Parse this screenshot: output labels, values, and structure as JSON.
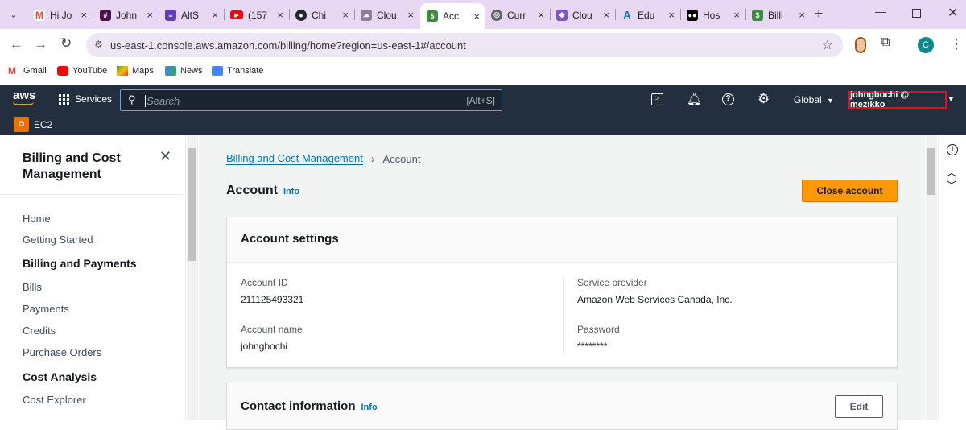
{
  "browser": {
    "tabs": [
      {
        "label": "Hi Jo",
        "icon": "gmail-icon"
      },
      {
        "label": "John",
        "icon": "slack-icon"
      },
      {
        "label": "AltS",
        "icon": "forms-icon"
      },
      {
        "label": "(157",
        "icon": "youtube-icon"
      },
      {
        "label": "Chi",
        "icon": "github-icon"
      },
      {
        "label": "Clou",
        "icon": "cloud-icon"
      },
      {
        "label": "Acc",
        "icon": "billing-icon",
        "active": true
      },
      {
        "label": "Curr",
        "icon": "globe-icon"
      },
      {
        "label": "Clou",
        "icon": "cloud-purple-icon"
      },
      {
        "label": "Edu",
        "icon": "azure-icon"
      },
      {
        "label": "Hos",
        "icon": "medium-icon"
      },
      {
        "label": "Billi",
        "icon": "billing-icon"
      }
    ],
    "url": "us-east-1.console.aws.amazon.com/billing/home?region=us-east-1#/account",
    "profile_initial": "C",
    "bookmarks": [
      {
        "label": "Gmail",
        "icon": "gmail-icon"
      },
      {
        "label": "YouTube",
        "icon": "youtube-icon"
      },
      {
        "label": "Maps",
        "icon": "maps-icon"
      },
      {
        "label": "News",
        "icon": "news-icon"
      },
      {
        "label": "Translate",
        "icon": "translate-icon"
      }
    ]
  },
  "aws_header": {
    "logo": "aws",
    "services_label": "Services",
    "search_placeholder": "Search",
    "search_shortcut": "[Alt+S]",
    "region_label": "Global",
    "account_label": "johngbochi @ mezikko",
    "pinned_service": "EC2"
  },
  "sidebar": {
    "title": "Billing and Cost Management",
    "items": [
      {
        "label": "Home",
        "type": "item"
      },
      {
        "label": "Getting Started",
        "type": "item"
      },
      {
        "label": "Billing and Payments",
        "type": "heading"
      },
      {
        "label": "Bills",
        "type": "item"
      },
      {
        "label": "Payments",
        "type": "item"
      },
      {
        "label": "Credits",
        "type": "item"
      },
      {
        "label": "Purchase Orders",
        "type": "item"
      },
      {
        "label": "Cost Analysis",
        "type": "heading"
      },
      {
        "label": "Cost Explorer",
        "type": "item"
      }
    ]
  },
  "main": {
    "breadcrumb": {
      "parent": "Billing and Cost Management",
      "current": "Account"
    },
    "page_title": "Account",
    "info_label": "Info",
    "close_account_label": "Close account",
    "account_settings": {
      "title": "Account settings",
      "account_id_label": "Account ID",
      "account_id_value": "211125493321",
      "account_name_label": "Account name",
      "account_name_value": "johngbochi",
      "service_provider_label": "Service provider",
      "service_provider_value": "Amazon Web Services Canada, Inc.",
      "password_label": "Password",
      "password_value": "********"
    },
    "contact_information": {
      "title": "Contact information",
      "info_label": "Info",
      "edit_label": "Edit"
    }
  },
  "colors": {
    "aws_nav": "#232f3e",
    "accent_orange": "#ff9900",
    "link_blue": "#0073bb",
    "highlight_red": "#e0101e"
  }
}
